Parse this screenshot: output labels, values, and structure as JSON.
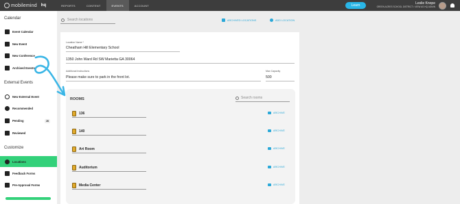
{
  "header": {
    "logo_text": "mobilemind",
    "logo_suffix": "hq",
    "nav": [
      "REPORTS",
      "CONTENT",
      "EVENTS",
      "ACCOUNT"
    ],
    "active_nav": "EVENTS",
    "learn_label": "Learn",
    "user_name": "Leslie Knope",
    "user_org": "GREEN ACRES SCHOOL DISTRICT • VIEW AS HQ ADMIN"
  },
  "sidebar": {
    "sections": [
      {
        "heading": "Calendar",
        "items": [
          {
            "label": "Event Calendar",
            "icon": "calendar-icon"
          },
          {
            "label": "New Event",
            "icon": "add-event-icon"
          },
          {
            "label": "New Conference",
            "icon": "conference-icon"
          },
          {
            "label": "Archived Events",
            "icon": "archive-icon"
          }
        ]
      },
      {
        "heading": "External Events",
        "items": [
          {
            "label": "New External Event",
            "icon": "plus-circle-icon"
          },
          {
            "label": "Recommended",
            "icon": "check-circle-icon"
          },
          {
            "label": "Pending",
            "icon": "clipboard-icon",
            "badge": "26"
          },
          {
            "label": "Reviewed",
            "icon": "reviewed-icon"
          }
        ]
      },
      {
        "heading": "Customize",
        "items": [
          {
            "label": "Locations",
            "icon": "location-pin-icon",
            "active": true
          },
          {
            "label": "Feedback Forms",
            "icon": "feedback-icon"
          },
          {
            "label": "Pre-Approval Forms",
            "icon": "approval-icon"
          }
        ]
      }
    ]
  },
  "main": {
    "search_placeholder": "Search locations",
    "archived_link": "ARCHIVED LOCATIONS",
    "add_link": "ADD LOCATION",
    "location_name_label": "Location Name *",
    "location_name": "Cheatham Hill Elementary School",
    "address": "1350 John Ward Rd SW Marietta GA 30064",
    "instructions_label": "Additional Instructions",
    "instructions": "Please make sure to park in the front lot.",
    "capacity_label": "Max Capacity",
    "capacity": "500"
  },
  "rooms": {
    "title": "ROOMS",
    "search_placeholder": "Search rooms",
    "archive_label": "ARCHIVE",
    "items": [
      "136",
      "140",
      "Art Room",
      "Auditorium",
      "Media Center"
    ]
  },
  "colors": {
    "accent": "#2aa8d8",
    "active_green": "#33d17a",
    "topbar": "#3d3d3d"
  }
}
